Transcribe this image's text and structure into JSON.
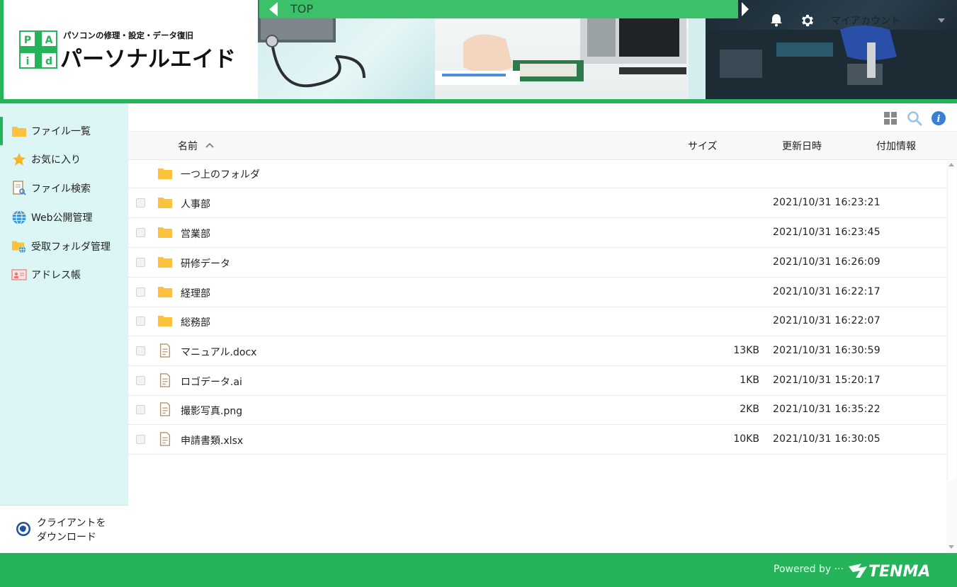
{
  "brand": {
    "tagline": "パソコンの修理・設定・データ復旧",
    "name": "パーソナルエイド",
    "accent": "#26b45a"
  },
  "topnav": {
    "label": "TOP"
  },
  "account": {
    "label": "マイアカウント"
  },
  "sidebar": {
    "items": [
      {
        "label": "ファイル一覧",
        "icon": "folder-icon"
      },
      {
        "label": "お気に入り",
        "icon": "star-icon"
      },
      {
        "label": "ファイル検索",
        "icon": "file-search-icon"
      },
      {
        "label": "Web公開管理",
        "icon": "globe-icon"
      },
      {
        "label": "受取フォルダ管理",
        "icon": "folder-globe-icon"
      },
      {
        "label": "アドレス帳",
        "icon": "address-book-icon"
      }
    ],
    "client_download": {
      "line1": "クライアントを",
      "line2": "ダウンロード"
    }
  },
  "columns": {
    "name": "名前",
    "size": "サイズ",
    "date": "更新日時",
    "extra": "付加情報"
  },
  "parent_folder": "一つ上のフォルダ",
  "files": [
    {
      "name": "人事部",
      "type": "folder",
      "size": "",
      "date": "2021/10/31 16:23:21"
    },
    {
      "name": "営業部",
      "type": "folder",
      "size": "",
      "date": "2021/10/31 16:23:45"
    },
    {
      "name": "研修データ",
      "type": "folder",
      "size": "",
      "date": "2021/10/31 16:26:09"
    },
    {
      "name": "経理部",
      "type": "folder",
      "size": "",
      "date": "2021/10/31 16:22:17"
    },
    {
      "name": "総務部",
      "type": "folder",
      "size": "",
      "date": "2021/10/31 16:22:07"
    },
    {
      "name": "マニュアル.docx",
      "type": "file",
      "size": "13KB",
      "date": "2021/10/31 16:30:59"
    },
    {
      "name": "ロゴデータ.ai",
      "type": "file",
      "size": "1KB",
      "date": "2021/10/31 15:20:17"
    },
    {
      "name": "撮影写真.png",
      "type": "file",
      "size": "2KB",
      "date": "2021/10/31 16:35:22"
    },
    {
      "name": "申請書類.xlsx",
      "type": "file",
      "size": "10KB",
      "date": "2021/10/31 16:30:05"
    }
  ],
  "footer": {
    "powered": "Powered by ···",
    "vendor": "TENMA"
  }
}
